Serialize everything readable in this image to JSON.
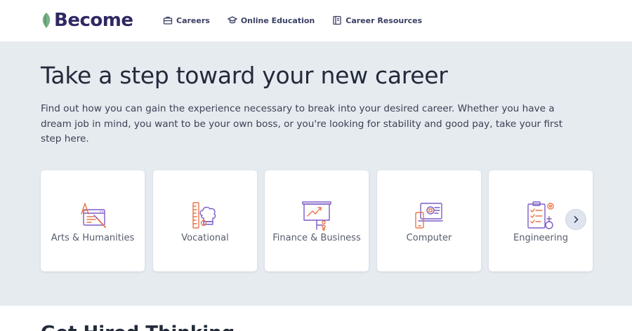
{
  "header": {
    "logo_text": "Become",
    "nav": [
      {
        "label": "Careers",
        "icon": "briefcase-icon"
      },
      {
        "label": "Online Education",
        "icon": "graduation-cap-icon"
      },
      {
        "label": "Career Resources",
        "icon": "book-icon"
      }
    ]
  },
  "hero": {
    "title": "Take a step toward your new career",
    "description": "Find out how you can gain the experience necessary to break into your desired career. Whether you have a dream job in mind, you want to be your own boss, or you're looking for stability and good pay, take your first step here.",
    "categories": [
      {
        "label": "Arts & Humanities",
        "icon": "arts-humanities-icon"
      },
      {
        "label": "Vocational",
        "icon": "vocational-icon"
      },
      {
        "label": "Finance & Business",
        "icon": "finance-business-icon"
      },
      {
        "label": "Computer",
        "icon": "computer-icon"
      },
      {
        "label": "Engineering",
        "icon": "engineering-icon"
      }
    ],
    "next_icon": "chevron-right-icon"
  },
  "section2": {
    "title": "Get Hired Thinking"
  },
  "colors": {
    "brand_dark": "#2f2863",
    "leaf_green": "#7bb38a",
    "hero_bg": "#e6ebf0",
    "icon_orange": "#e8764a",
    "icon_purple": "#7d5cc6"
  }
}
